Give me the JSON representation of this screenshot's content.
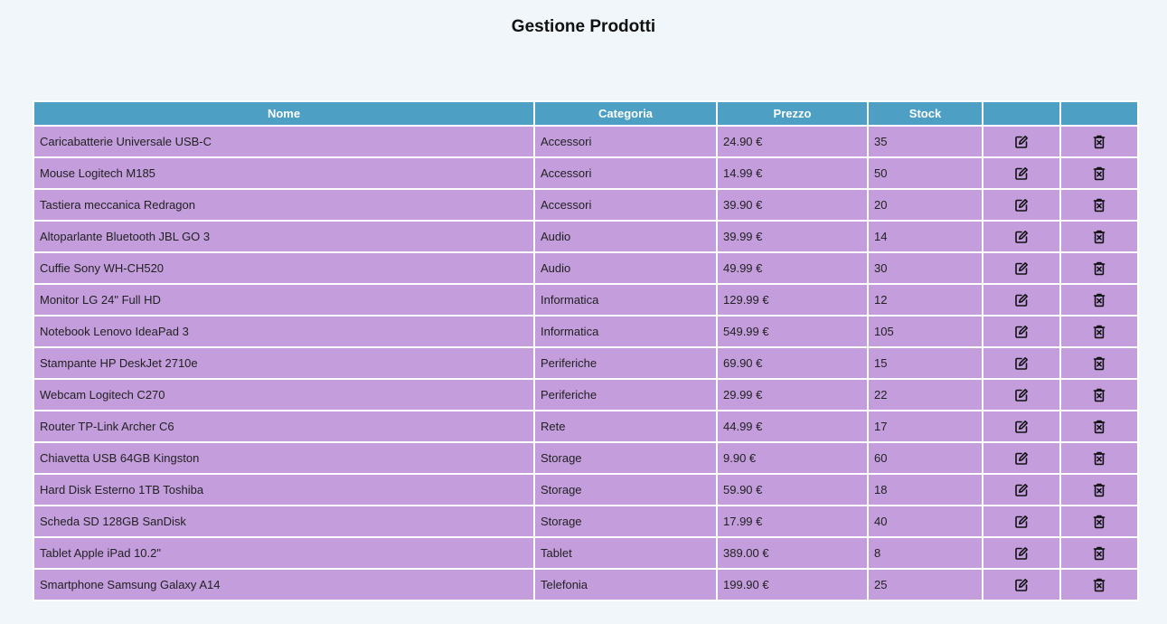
{
  "page_title": "Gestione Prodotti",
  "table": {
    "headers": {
      "name": "Nome",
      "category": "Categoria",
      "price": "Prezzo",
      "stock": "Stock",
      "edit": "",
      "delete": ""
    },
    "rows": [
      {
        "name": "Caricabatterie Universale USB-C",
        "category": "Accessori",
        "price": "24.90 €",
        "stock": "35"
      },
      {
        "name": "Mouse Logitech M185",
        "category": "Accessori",
        "price": "14.99 €",
        "stock": "50"
      },
      {
        "name": "Tastiera meccanica Redragon",
        "category": "Accessori",
        "price": "39.90 €",
        "stock": "20"
      },
      {
        "name": "Altoparlante Bluetooth JBL GO 3",
        "category": "Audio",
        "price": "39.99 €",
        "stock": "14"
      },
      {
        "name": "Cuffie Sony WH-CH520",
        "category": "Audio",
        "price": "49.99 €",
        "stock": "30"
      },
      {
        "name": "Monitor LG 24\" Full HD",
        "category": "Informatica",
        "price": "129.99 €",
        "stock": "12"
      },
      {
        "name": "Notebook Lenovo IdeaPad 3",
        "category": "Informatica",
        "price": "549.99 €",
        "stock": "105"
      },
      {
        "name": "Stampante HP DeskJet 2710e",
        "category": "Periferiche",
        "price": "69.90 €",
        "stock": "15"
      },
      {
        "name": "Webcam Logitech C270",
        "category": "Periferiche",
        "price": "29.99 €",
        "stock": "22"
      },
      {
        "name": "Router TP-Link Archer C6",
        "category": "Rete",
        "price": "44.99 €",
        "stock": "17"
      },
      {
        "name": "Chiavetta USB 64GB Kingston",
        "category": "Storage",
        "price": "9.90 €",
        "stock": "60"
      },
      {
        "name": "Hard Disk Esterno 1TB Toshiba",
        "category": "Storage",
        "price": "59.90 €",
        "stock": "18"
      },
      {
        "name": "Scheda SD 128GB SanDisk",
        "category": "Storage",
        "price": "17.99 €",
        "stock": "40"
      },
      {
        "name": "Tablet Apple iPad 10.2\"",
        "category": "Tablet",
        "price": "389.00 €",
        "stock": "8"
      },
      {
        "name": "Smartphone Samsung Galaxy A14",
        "category": "Telefonia",
        "price": "199.90 €",
        "stock": "25"
      }
    ],
    "row_actions": {
      "edit_icon": "edit-icon",
      "delete_icon": "delete-icon"
    }
  },
  "colors": {
    "background": "#f0f6f9",
    "header_bg": "#4d9fc4",
    "row_bg": "#c39ddc"
  }
}
